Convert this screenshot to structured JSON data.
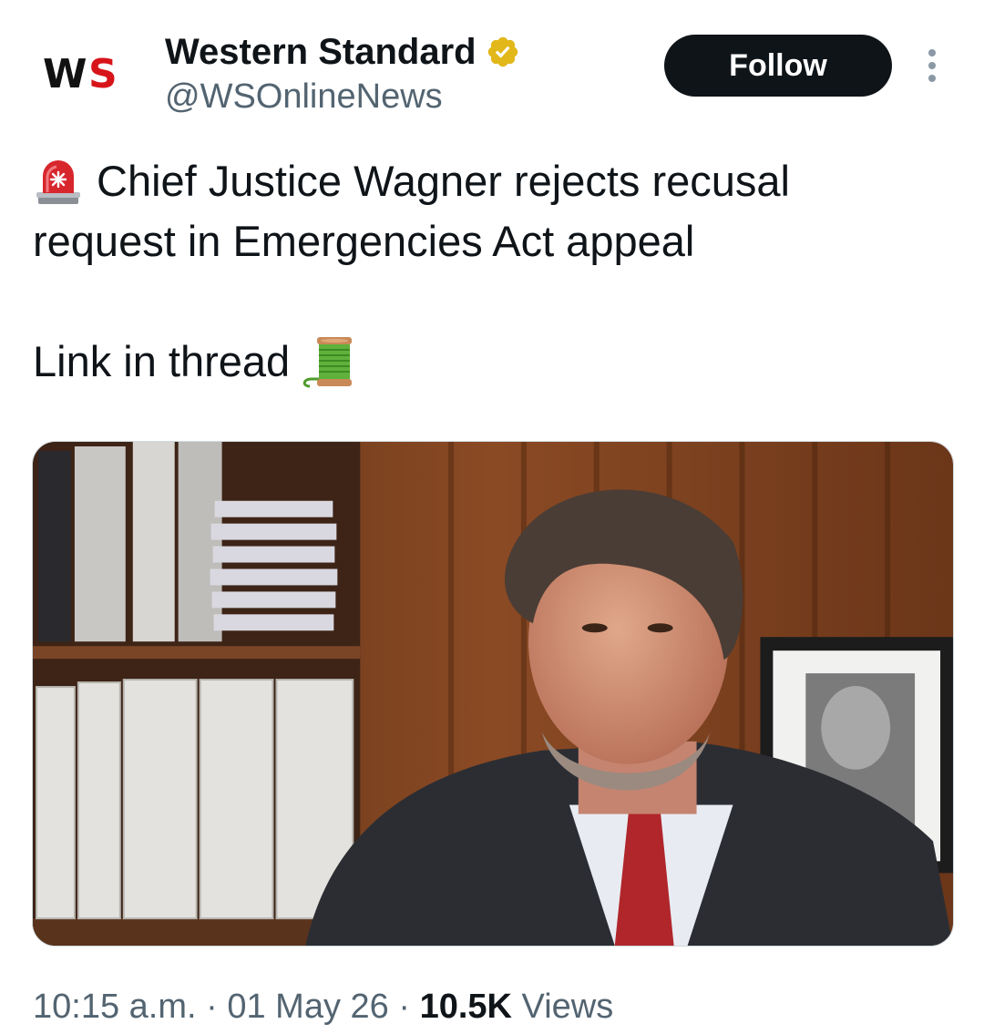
{
  "author": {
    "avatar_text_black": "W",
    "avatar_text_red": "S",
    "display_name": "Western Standard",
    "handle": "@WSOnlineNews",
    "verified_badge_color": "#e2b719"
  },
  "actions": {
    "follow_label": "Follow"
  },
  "tweet": {
    "line1": "Chief Justice Wagner rejects recusal",
    "line2": "request in Emergencies Act appeal",
    "line3": "Link in thread",
    "leading_icon": "police-car-light-icon",
    "trailing_icon": "spool-of-thread-icon"
  },
  "meta": {
    "time": "10:15 a.m.",
    "sep1": " · ",
    "date": "01 May 26",
    "sep2": " · ",
    "views_count": "10.5K",
    "views_label": " Views"
  },
  "colors": {
    "follow_bg": "#0f1419",
    "secondary_text": "#536471",
    "brand_red": "#d7141a"
  }
}
